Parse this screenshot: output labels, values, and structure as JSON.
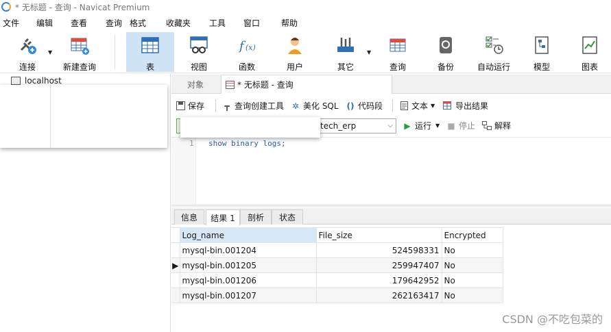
{
  "window": {
    "title": "* 无标题 - 查询 - Navicat Premium"
  },
  "menu": [
    "文件",
    "编辑",
    "查看",
    "查询",
    "格式",
    "收藏夹",
    "工具",
    "窗口",
    "帮助"
  ],
  "toolbar": {
    "items": [
      {
        "label": "连接",
        "icon": "plug-icon"
      },
      {
        "label": "新建查询",
        "icon": "new-query-icon"
      },
      {
        "label": "表",
        "icon": "table-icon",
        "active": true
      },
      {
        "label": "视图",
        "icon": "view-icon"
      },
      {
        "label": "函数",
        "icon": "function-icon"
      },
      {
        "label": "用户",
        "icon": "user-icon"
      },
      {
        "label": "其它",
        "icon": "tools-icon"
      },
      {
        "label": "查询",
        "icon": "query-icon"
      },
      {
        "label": "备份",
        "icon": "backup-icon"
      },
      {
        "label": "自动运行",
        "icon": "schedule-icon"
      },
      {
        "label": "模型",
        "icon": "model-icon"
      },
      {
        "label": "图表",
        "icon": "chart-icon"
      }
    ]
  },
  "sidebar": {
    "connection": "localhost"
  },
  "doc_tabs": {
    "objects": "对象",
    "query": "* 无标题 - 查询"
  },
  "query_toolbar": {
    "save": "保存",
    "builder": "查询创建工具",
    "beautify": "美化 SQL",
    "snippet": "代码段",
    "text": "文本",
    "export": "导出结果"
  },
  "connection_bar": {
    "database": "tech_erp",
    "run": "运行",
    "stop": "停止",
    "explain": "解释"
  },
  "editor": {
    "line": "1",
    "code": "show binary logs;"
  },
  "result_tabs": [
    "信息",
    "结果 1",
    "剖析",
    "状态"
  ],
  "result": {
    "columns": [
      "Log_name",
      "File_size",
      "Encrypted"
    ],
    "rows": [
      [
        "mysql-bin.001204",
        "524598331",
        "No"
      ],
      [
        "mysql-bin.001205",
        "259947407",
        "No"
      ],
      [
        "mysql-bin.001206",
        "179642952",
        "No"
      ],
      [
        "mysql-bin.001207",
        "262163417",
        "No"
      ]
    ]
  },
  "watermark": "CSDN @不吃包菜的"
}
